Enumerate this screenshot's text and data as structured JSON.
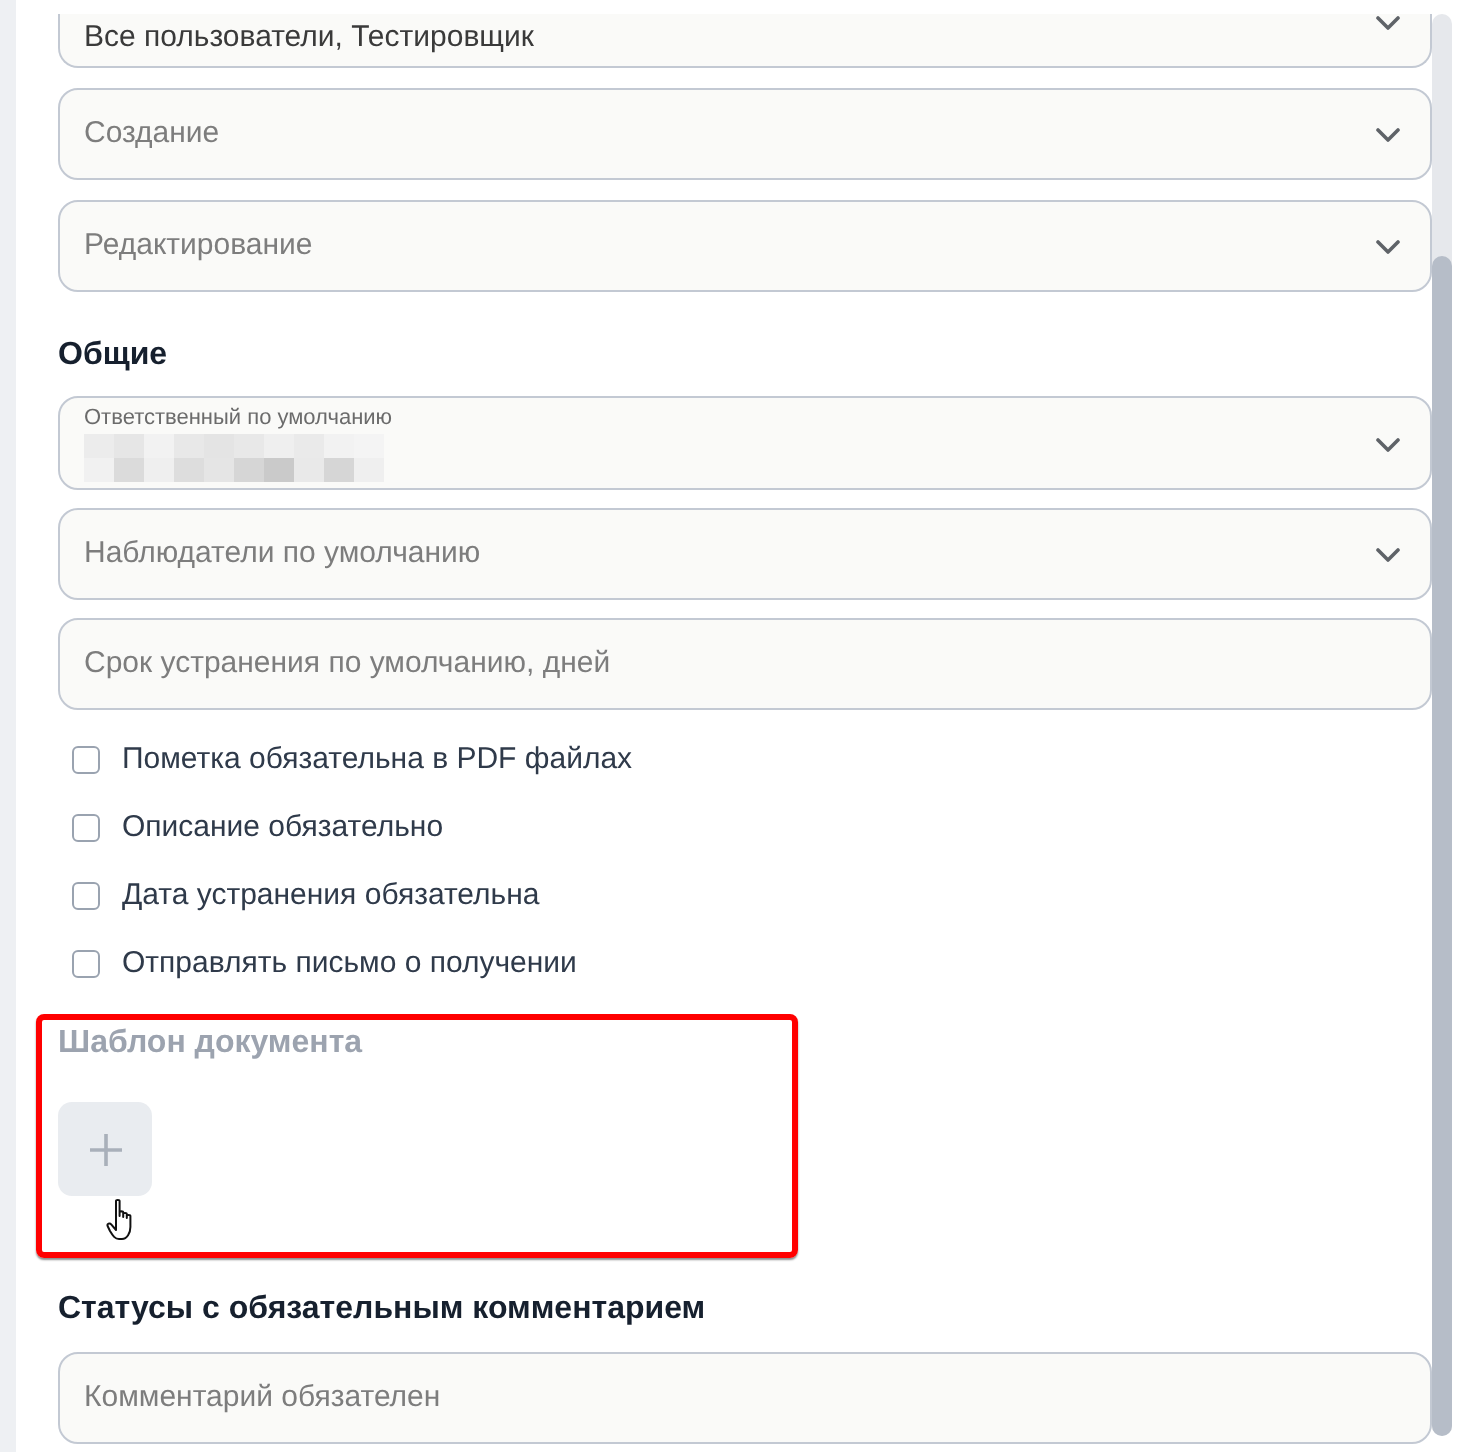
{
  "access": {
    "fields": [
      {
        "kind": "select",
        "value": "Все пользователи, Тестировщик"
      },
      {
        "kind": "select",
        "placeholder": "Создание"
      },
      {
        "kind": "select",
        "placeholder": "Редактирование"
      }
    ]
  },
  "general": {
    "title": "Общие",
    "fields": [
      {
        "kind": "select",
        "label": "Ответственный по умолчанию",
        "value_blurred": true
      },
      {
        "kind": "select",
        "placeholder": "Наблюдатели по умолчанию"
      },
      {
        "kind": "input",
        "placeholder": "Срок устранения по умолчанию, дней"
      }
    ],
    "checkboxes": [
      {
        "label": "Пометка обязательна в PDF файлах",
        "checked": false
      },
      {
        "label": "Описание обязательно",
        "checked": false
      },
      {
        "label": "Дата устранения обязательна",
        "checked": false
      },
      {
        "label": "Отправлять письмо о получении",
        "checked": false
      }
    ]
  },
  "document_template": {
    "title": "Шаблон документа",
    "highlighted": true,
    "add_button": {
      "hovered": true
    }
  },
  "comment_statuses": {
    "title": "Статусы с обязательным комментарием",
    "fields": [
      {
        "kind": "input",
        "placeholder": "Комментарий обязателен"
      }
    ]
  }
}
